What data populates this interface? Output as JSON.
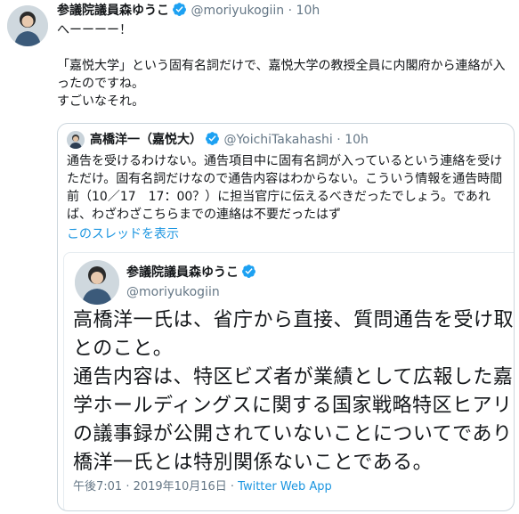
{
  "tweet": {
    "name": "参議院議員森ゆうこ",
    "handle": "@moriyukogiin",
    "separator": "·",
    "time": "10h",
    "text": "へーーーー！\n\n「嘉悦大学」という固有名詞だけで、嘉悦大学の教授全員に内閣府から連絡が入ったのですね。\nすごいなそれ。"
  },
  "quoted": {
    "name": "高橋洋一（嘉悦大）",
    "handle": "@YoichiTakahashi",
    "separator": "·",
    "time": "10h",
    "text": "通告を受けるわけない。通告項目中に固有名詞が入っているという連絡を受けただけ。固有名詞だけなので通告内容はわからない。こういう情報を通告時間前（10／17　17：00？）に担当官庁に伝えるべきだったでしょう。であれば、わざわざこちらまでの連絡は不要だったはず",
    "show_thread": "このスレッドを表示"
  },
  "embedded": {
    "name": "参議院議員森ゆうこ",
    "handle": "@moriyukogiin",
    "text": "高橋洋一氏は、省庁から直接、質問通告を受け取\nとのこと。\n通告内容は、特区ビズ者が業績として広報した嘉\n学ホールディングスに関する国家戦略特区ヒアリ\nの議事録が公開されていないことについてであり\n橋洋一氏とは特別関係ないことである。",
    "timestamp": "午後7:01 · 2019年10月16日 · ",
    "source": "Twitter Web App"
  },
  "icons": {
    "verified": "verified-badge-icon",
    "avatar": "user-avatar"
  },
  "colors": {
    "link": "#1b95e0",
    "muted": "#657786",
    "verified": "#1da1f2",
    "border": "#ccd6dd"
  }
}
